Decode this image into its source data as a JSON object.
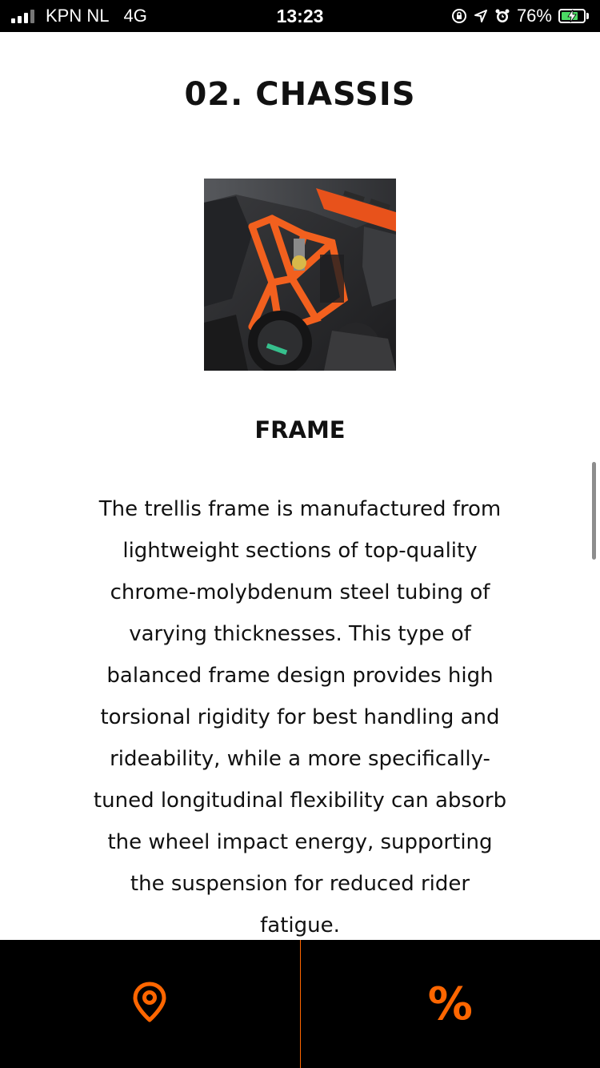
{
  "status_bar": {
    "carrier": "KPN NL",
    "network": "4G",
    "time": "13:23",
    "battery_percent_label": "76%",
    "battery_level": 0.76,
    "icons": [
      "signal-icon",
      "rotation-lock-icon",
      "location-icon",
      "alarm-icon",
      "battery-icon"
    ]
  },
  "section": {
    "title": "02. CHASSIS"
  },
  "feature": {
    "image_icon": "motorcycle-frame-photo",
    "heading": "FRAME",
    "description": "The trellis frame is manufactured from lightweight sections of top-quality chrome-molybdenum steel tubing of varying thicknesses. This type of balanced frame design provides high torsional rigidity for best handling and rideability, while a more specifically-tuned longitudinal flexibility can absorb the wheel impact energy, supporting the suspension for reduced rider fatigue."
  },
  "bottom_bar": {
    "left_icon": "location-pin-icon",
    "right_icon": "percent-icon",
    "right_glyph": "%"
  },
  "colors": {
    "accent": "#ff6600",
    "frame_orange": "#f2601e",
    "bar_background": "#000000"
  }
}
